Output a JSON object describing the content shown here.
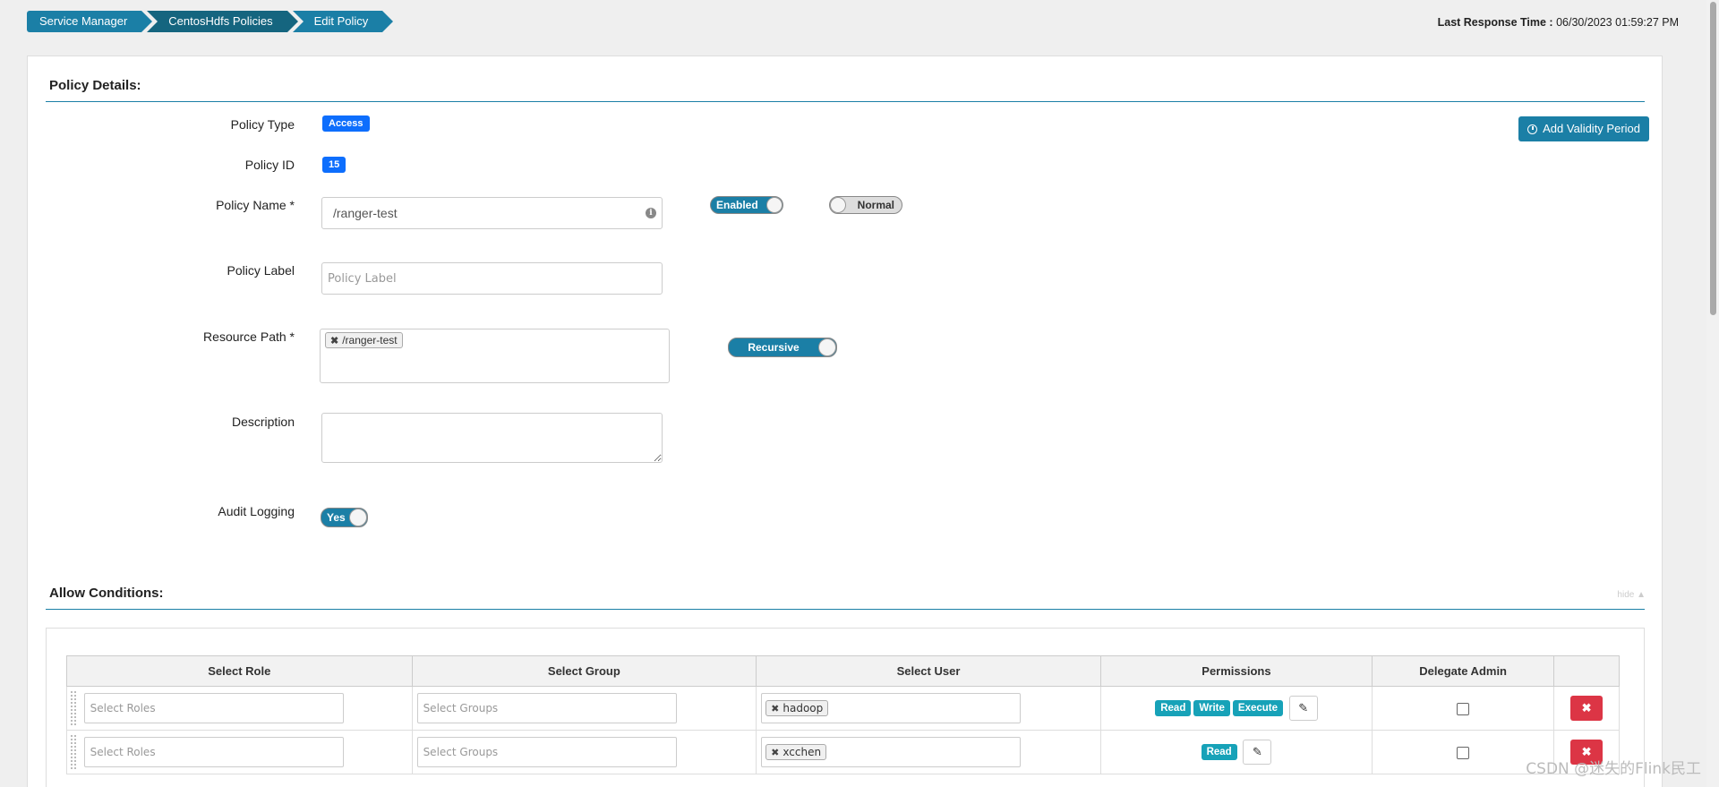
{
  "breadcrumbs": [
    "Service Manager",
    "CentosHdfs Policies",
    "Edit Policy"
  ],
  "last_response": {
    "label": "Last Response Time :",
    "value": "06/30/2023 01:59:27 PM"
  },
  "policy_details": {
    "title": "Policy Details:",
    "add_validity_label": "Add Validity Period",
    "policy_type_label": "Policy Type",
    "policy_type_value": "Access",
    "policy_id_label": "Policy ID",
    "policy_id_value": "15",
    "policy_name_label": "Policy Name *",
    "policy_name_value": "/ranger-test",
    "enabled_toggle": "Enabled",
    "normal_toggle": "Normal",
    "policy_label_label": "Policy Label",
    "policy_label_placeholder": "Policy Label",
    "resource_path_label": "Resource Path *",
    "resource_path_tag": "/ranger-test",
    "recursive_toggle": "Recursive",
    "description_label": "Description",
    "audit_logging_label": "Audit Logging",
    "audit_toggle": "Yes"
  },
  "allow_conditions": {
    "title": "Allow Conditions:",
    "hide_link": "hide ▲",
    "columns": [
      "Select Role",
      "Select Group",
      "Select User",
      "Permissions",
      "Delegate Admin",
      ""
    ],
    "rows": [
      {
        "role_placeholder": "Select Roles",
        "group_placeholder": "Select Groups",
        "user": "hadoop",
        "permissions": [
          "Read",
          "Write",
          "Execute"
        ]
      },
      {
        "role_placeholder": "Select Roles",
        "group_placeholder": "Select Groups",
        "user": "xcchen",
        "permissions": [
          "Read"
        ]
      }
    ]
  },
  "watermark": "CSDN @迷失的Flink民工",
  "colors": {
    "accent": "#1b7fa6",
    "badge": "#0d6efd",
    "permission": "#17a2b8",
    "danger": "#dc3545"
  }
}
